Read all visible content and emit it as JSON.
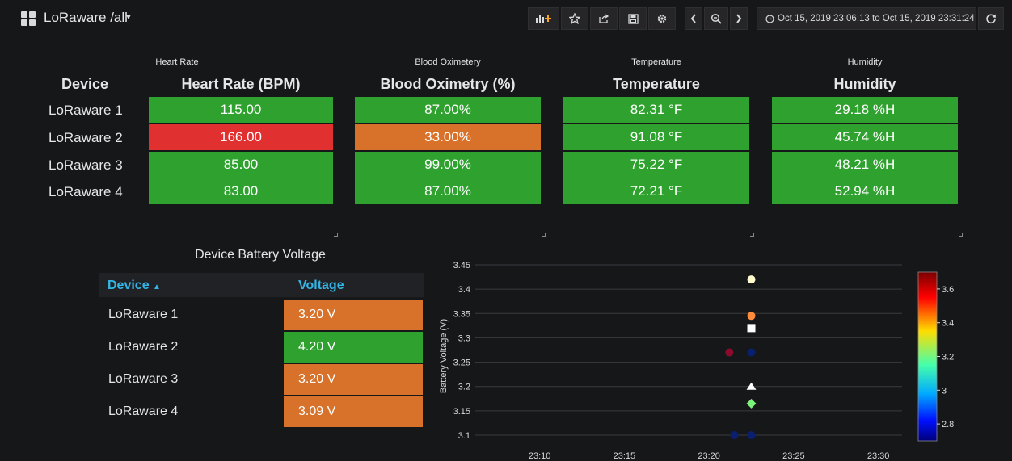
{
  "header": {
    "title": "LoRaware /all",
    "time_range": "Oct 15, 2019 23:06:13 to Oct 15, 2019 23:31:24"
  },
  "summary_table": {
    "device_header": "Device",
    "columns": [
      {
        "panel_title": "Heart Rate",
        "header": "Heart Rate (BPM)"
      },
      {
        "panel_title": "Blood Oximetery",
        "header": "Blood Oximetry (%)"
      },
      {
        "panel_title": "Temperature",
        "header": "Temperature"
      },
      {
        "panel_title": "Humidity",
        "header": "Humidity"
      }
    ],
    "rows": [
      {
        "device": "LoRaware 1",
        "values": [
          "115.00",
          "87.00%",
          "82.31 °F",
          "29.18 %H"
        ],
        "status": [
          "ok",
          "ok",
          "ok",
          "ok"
        ]
      },
      {
        "device": "LoRaware 2",
        "values": [
          "166.00",
          "33.00%",
          "91.08 °F",
          "45.74 %H"
        ],
        "status": [
          "critical",
          "warning",
          "ok",
          "ok"
        ]
      },
      {
        "device": "LoRaware 3",
        "values": [
          "85.00",
          "99.00%",
          "75.22 °F",
          "48.21 %H"
        ],
        "status": [
          "ok",
          "ok",
          "ok",
          "ok"
        ]
      },
      {
        "device": "LoRaware 4",
        "values": [
          "83.00",
          "87.00%",
          "72.21 °F",
          "52.94 %H"
        ],
        "status": [
          "ok",
          "ok",
          "ok",
          "ok"
        ]
      }
    ]
  },
  "battery_table": {
    "title": "Device Battery Voltage",
    "col_device": "Device",
    "col_voltage": "Voltage",
    "rows": [
      {
        "device": "LoRaware 1",
        "voltage": "3.20 V",
        "status": "warning"
      },
      {
        "device": "LoRaware 2",
        "voltage": "4.20 V",
        "status": "ok"
      },
      {
        "device": "LoRaware 3",
        "voltage": "3.20 V",
        "status": "warning"
      },
      {
        "device": "LoRaware 4",
        "voltage": "3.09 V",
        "status": "warning"
      }
    ]
  },
  "colors": {
    "ok": "#2ea12e",
    "warning": "#d8722a",
    "critical": "#e0302f",
    "accent": "#33b5e5"
  },
  "chart_data": {
    "type": "scatter",
    "ylabel": "Battery Voltage (V)",
    "xlabel": "",
    "x_ticks": [
      "23:10",
      "23:15",
      "23:20",
      "23:25",
      "23:30"
    ],
    "y_ticks": [
      "3.45",
      "3.4",
      "3.35",
      "3.3",
      "3.25",
      "3.2",
      "3.15",
      "3.1"
    ],
    "ylim": [
      3.1,
      3.45
    ],
    "xlim_minutes": [
      23.1667,
      23.525
    ],
    "points": [
      {
        "x": "23:22.5",
        "y": 3.42,
        "shape": "circle",
        "color": "#fffacd"
      },
      {
        "x": "23:22.5",
        "y": 3.345,
        "shape": "circle",
        "color": "#ff8c3a"
      },
      {
        "x": "23:22.5",
        "y": 3.32,
        "shape": "square",
        "color": "#ffffff"
      },
      {
        "x": "23:21.2",
        "y": 3.27,
        "shape": "circle",
        "color": "#8b0a2e"
      },
      {
        "x": "23:22.5",
        "y": 3.27,
        "shape": "circle",
        "color": "#0a1f6e"
      },
      {
        "x": "23:22.5",
        "y": 3.2,
        "shape": "triangle",
        "color": "#ffffff"
      },
      {
        "x": "23:22.5",
        "y": 3.165,
        "shape": "diamond",
        "color": "#7cf27c"
      },
      {
        "x": "23:21.5",
        "y": 3.1,
        "shape": "circle",
        "color": "#0a1f6e"
      },
      {
        "x": "23:22.5",
        "y": 3.1,
        "shape": "circle",
        "color": "#0a1f6e"
      }
    ],
    "colorbar": {
      "ticks": [
        "3.6",
        "3.4",
        "3.2",
        "3",
        "2.8"
      ],
      "range": [
        2.7,
        3.7
      ]
    }
  }
}
